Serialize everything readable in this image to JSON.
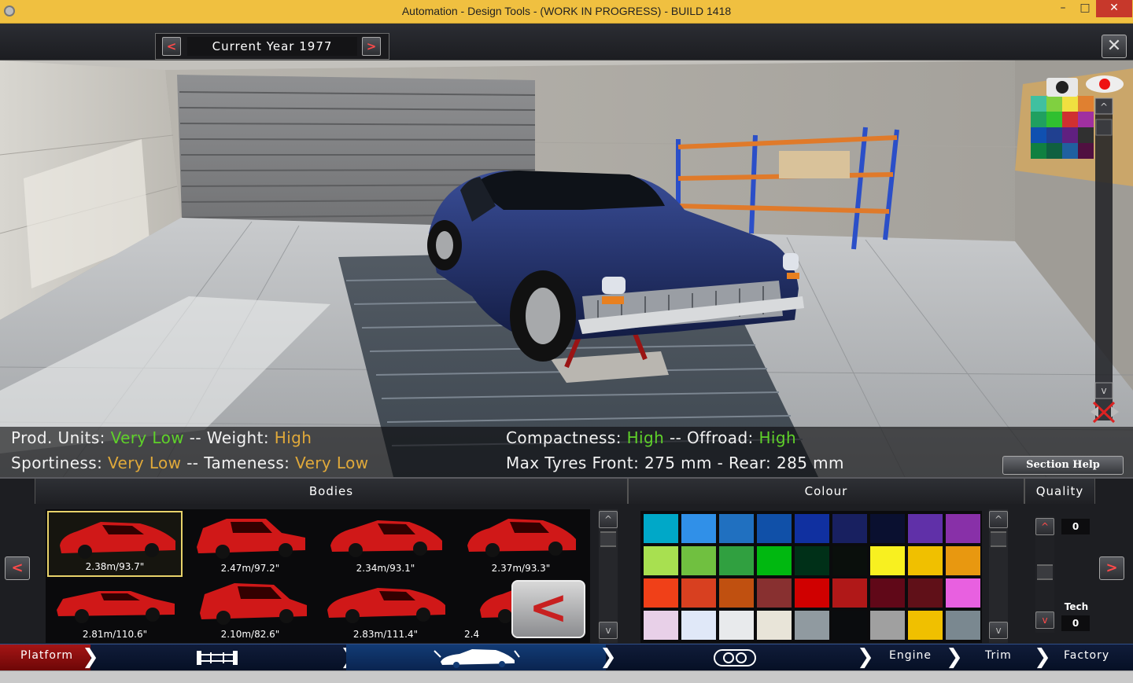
{
  "window": {
    "title": "Automation - Design Tools - (WORK IN PROGRESS) - BUILD 1418",
    "minimize_glyph": "–",
    "maximize_glyph": "□",
    "close_glyph": "✕"
  },
  "header": {
    "prev_label": "<",
    "next_label": ">",
    "year_label": "Current Year 1977",
    "close_label": "✕"
  },
  "stats": {
    "prod_units_label": "Prod. Units:",
    "prod_units_value": "Very Low",
    "sep1": "--",
    "weight_label": "Weight:",
    "weight_value": "High",
    "sportiness_label": "Sportiness:",
    "sportiness_value": "Very Low",
    "sep2": "--",
    "tameness_label": "Tameness:",
    "tameness_value": "Very Low",
    "compactness_label": "Compactness:",
    "compactness_value": "High",
    "sep3": "--",
    "offroad_label": "Offroad:",
    "offroad_value": "High",
    "tyres_text": "Max Tyres Front: 275 mm - Rear: 285 mm"
  },
  "section_help_label": "Section Help",
  "bodies": {
    "header": "Bodies",
    "items": [
      {
        "dimensions": "2.38m/93.7\"",
        "selected": true
      },
      {
        "dimensions": "2.47m/97.2\"",
        "selected": false
      },
      {
        "dimensions": "2.34m/93.1\"",
        "selected": false
      },
      {
        "dimensions": "2.37m/93.3\"",
        "selected": false
      },
      {
        "dimensions": "2.81m/110.6\"",
        "selected": false
      },
      {
        "dimensions": "2.10m/82.6\"",
        "selected": false
      },
      {
        "dimensions": "2.83m/111.4\"",
        "selected": false
      },
      {
        "dimensions": "2.4",
        "selected": false
      }
    ],
    "back_label": "<",
    "scroll_up": "^",
    "scroll_down": "v"
  },
  "colour": {
    "header": "Colour",
    "swatches": [
      "#00a8c8",
      "#3090e8",
      "#2070c0",
      "#1050a8",
      "#1030a0",
      "#182060",
      "#0a1030",
      "#6030a8",
      "#8830a8",
      "#a8e050",
      "#70c040",
      "#30a040",
      "#00b810",
      "#003018",
      "#0a0f0c",
      "#f8f020",
      "#f0c000",
      "#e89810",
      "#f04018",
      "#d84020",
      "#c05010",
      "#883030",
      "#d00000",
      "#b01818",
      "#600818",
      "#601018",
      "#e860e0",
      "#e8d0e8",
      "#e0e8f8",
      "#e8eaec",
      "#e8e4d8",
      "#909aa0",
      "#0a0c0e",
      "#a0a0a0",
      "#f0c000",
      "#7a8890"
    ],
    "scroll_up": "^",
    "scroll_down": "v"
  },
  "quality": {
    "header": "Quality",
    "up_label": "^",
    "down_label": "v",
    "quality_value": "0",
    "tech_label": "Tech",
    "tech_value": "0",
    "prev_label": "<",
    "next_label": ">"
  },
  "nav": {
    "platform": "Platform",
    "engine": "Engine",
    "trim": "Trim",
    "factory": "Factory",
    "chevron": "❯",
    "chassis_icon": "chassis-icon",
    "body_icon": "car-body-icon",
    "lights_icon": "headlights-icon"
  },
  "colors": {
    "positive": "#5fd12a",
    "warning": "#e0a93a",
    "car_paint": "#1b2b66",
    "body_red": "#d01818"
  }
}
